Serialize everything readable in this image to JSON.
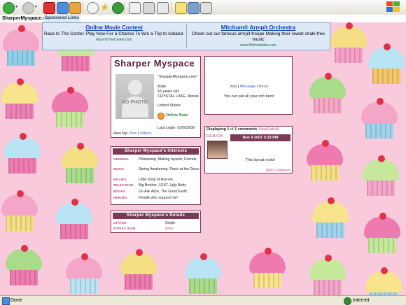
{
  "browser": {
    "address": "SharperMyspace.com",
    "status_text": "Done",
    "zone_text": "Internet"
  },
  "ads": {
    "label": "Sponsored Links",
    "left": {
      "title": "Online Movie Contest",
      "text": "Race to The Center. Play Now For a Chance To Win a Trip to Iceland.",
      "url": "RaceToTheCenter.com"
    },
    "right": {
      "title": "Mitchum® Armpit Orchestra",
      "text": "Check out our famous armpit troupe Making their sweet chalk-free music",
      "url": "www.MitchumMan.com"
    }
  },
  "profile": {
    "name": "Sharper Myspace",
    "photo_label": "NO PHOTO",
    "quote": "\"SharperMyspace.com\"",
    "gender": "Male",
    "age": "16 years old",
    "location": "CRYSTAL LAKE, Illinois",
    "country": "United States",
    "online": "Online Now!",
    "last_login": "Last Login: 6/26/2008",
    "view_my": "View My:",
    "pics": "Pics",
    "sep": "|",
    "videos": "Videos"
  },
  "interests": {
    "title": "Sharper Myspace's Interests",
    "rows": [
      {
        "label": "GENERAL",
        "value": "Photoshop, Making layouts, Friends"
      },
      {
        "label": "MUSIC",
        "value": "Spring Awakening, Panic at the Disco"
      },
      {
        "label": "MOVIES",
        "value": "Little Shop of Horrors"
      },
      {
        "label": "TELEVISION",
        "value": "Big Brother, LOST, Ugly Betty"
      },
      {
        "label": "BOOKS",
        "value": "Go Ask Alice, The Good Earth"
      },
      {
        "label": "HEROES",
        "value": "People who support me!"
      }
    ]
  },
  "details": {
    "title": "Sharper Myspace's Details",
    "rows": [
      {
        "label": "STATUS:",
        "value": "Single"
      },
      {
        "label": "ZODIAC SIGN:",
        "value": "Aries"
      }
    ]
  },
  "info_box": {
    "add": "Add",
    "message": "Message",
    "block": "Block",
    "sep": "|",
    "text": "You can put all your info here!"
  },
  "comments": {
    "displaying": "Displaying",
    "count": "1",
    "of_text": "of",
    "total": "1",
    "comments_word": "comments",
    "view_all": "View/Edit All",
    "author": "DERICK",
    "date": "Nov 4 2007 5:33 PM",
    "body": "This layout rocks!",
    "add_comment": "Add Comment"
  },
  "colors": {
    "accent": "#7a3a55",
    "pink_bg": "#f9cadb"
  }
}
